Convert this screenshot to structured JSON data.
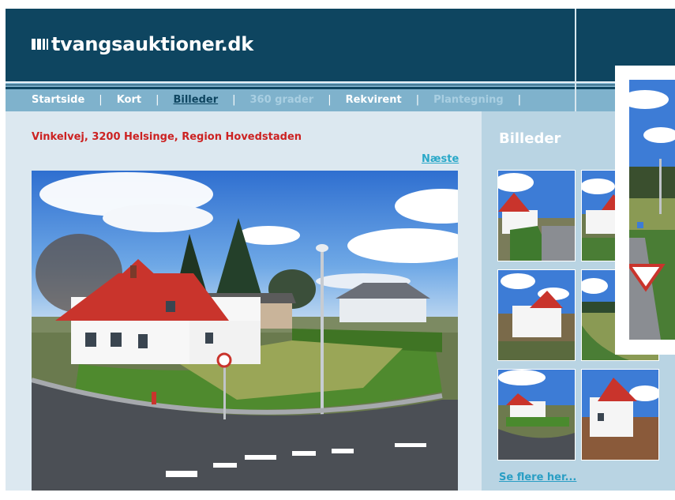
{
  "site": {
    "logo_text": "tvangsauktioner.dk",
    "logo_icon": "bars-icon"
  },
  "nav": {
    "items": [
      {
        "label": "Startside",
        "state": "normal"
      },
      {
        "label": "Kort",
        "state": "normal"
      },
      {
        "label": "Billeder",
        "state": "active"
      },
      {
        "label": "360 grader",
        "state": "disabled"
      },
      {
        "label": "Rekvirent",
        "state": "normal"
      },
      {
        "label": "Plantegning",
        "state": "disabled"
      }
    ],
    "separator": "|"
  },
  "main": {
    "address": "Vinkelvej, 3200 Helsinge, Region Hovedstaden",
    "next_link": "Næste"
  },
  "sidebar": {
    "title": "Billeder",
    "more_link": "Se flere her...",
    "thumbnail_count": 6
  },
  "colors": {
    "header_bg": "#0e4560",
    "nav_bg": "#7fb2cc",
    "address_red": "#cc2222",
    "link_cyan": "#29a8c8",
    "main_bg": "#dce8f0",
    "sidebar_bg": "#b9d4e3"
  }
}
